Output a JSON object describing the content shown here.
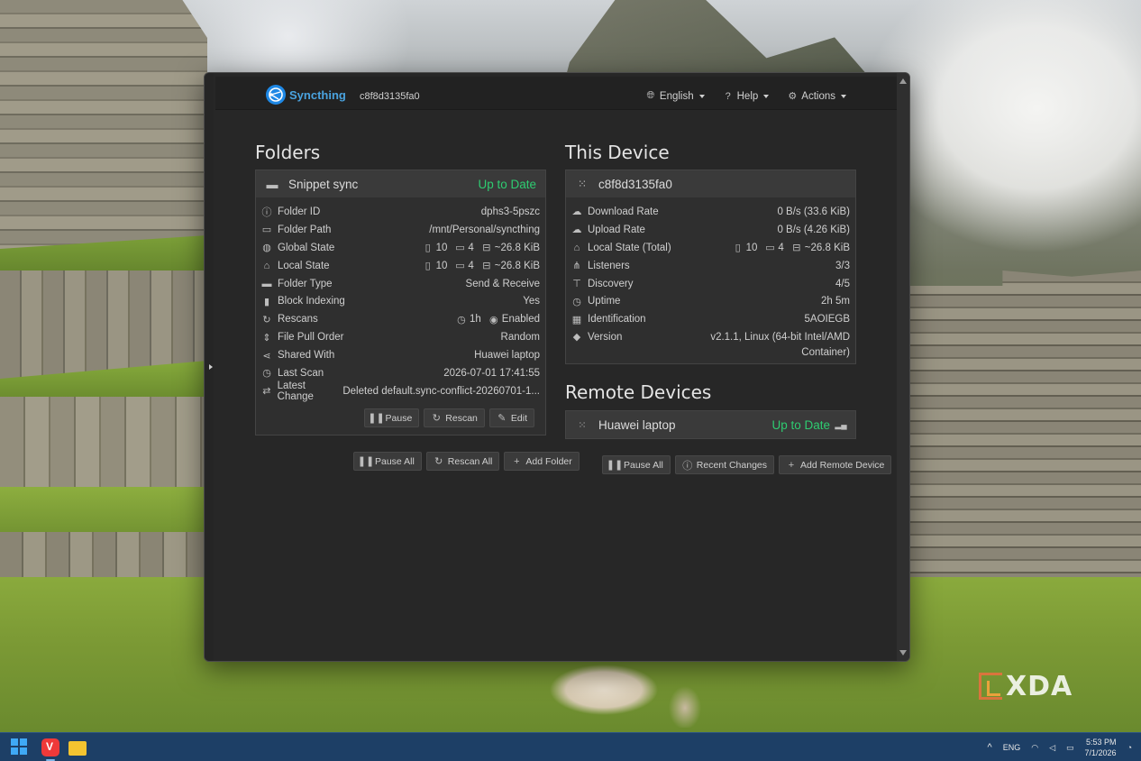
{
  "app": {
    "brand": "Syncthing",
    "device_id": "c8f8d3135fa0",
    "nav": {
      "language": "English",
      "help": "Help",
      "actions": "Actions"
    }
  },
  "folders": {
    "heading": "Folders",
    "panel": {
      "name": "Snippet sync",
      "status": "Up to Date",
      "rows": [
        {
          "icon": "info-icon",
          "label": "Folder ID",
          "value": "dphs3-5pszc"
        },
        {
          "icon": "folder-open-icon",
          "label": "Folder Path",
          "value": "/mnt/Personal/syncthing"
        },
        {
          "icon": "globe-icon",
          "label": "Global State",
          "files": "10",
          "dirs": "4",
          "size": "~26.8 KiB"
        },
        {
          "icon": "home-icon",
          "label": "Local State",
          "files": "10",
          "dirs": "4",
          "size": "~26.8 KiB"
        },
        {
          "icon": "folder-icon",
          "label": "Folder Type",
          "value": "Send & Receive"
        },
        {
          "icon": "book-icon",
          "label": "Block Indexing",
          "value": "Yes"
        },
        {
          "icon": "refresh-icon",
          "label": "Rescans",
          "interval": "1h",
          "watch": "Enabled"
        },
        {
          "icon": "sort-icon",
          "label": "File Pull Order",
          "value": "Random"
        },
        {
          "icon": "share-icon",
          "label": "Shared With",
          "value": "Huawei laptop"
        },
        {
          "icon": "clock-icon",
          "label": "Last Scan",
          "value": "2026-07-01 17:41:55"
        },
        {
          "icon": "exchange-icon",
          "label": "Latest Change",
          "value": "Deleted default.sync-conflict-20260701-1..."
        }
      ],
      "buttons": {
        "pause": "Pause",
        "rescan": "Rescan",
        "edit": "Edit"
      }
    },
    "buttons": {
      "pause_all": "Pause All",
      "rescan_all": "Rescan All",
      "add_folder": "Add Folder"
    }
  },
  "this_device": {
    "heading": "This Device",
    "name": "c8f8d3135fa0",
    "rows": [
      {
        "icon": "cloud-download-icon",
        "label": "Download Rate",
        "value": "0 B/s (33.6 KiB)"
      },
      {
        "icon": "cloud-upload-icon",
        "label": "Upload Rate",
        "value": "0 B/s (4.26 KiB)"
      },
      {
        "icon": "home-icon",
        "label": "Local State (Total)",
        "files": "10",
        "dirs": "4",
        "size": "~26.8 KiB"
      },
      {
        "icon": "sitemap-icon",
        "label": "Listeners",
        "value": "3/3"
      },
      {
        "icon": "signpost-icon",
        "label": "Discovery",
        "value": "4/5"
      },
      {
        "icon": "clock-icon",
        "label": "Uptime",
        "value": "2h 5m"
      },
      {
        "icon": "qrcode-icon",
        "label": "Identification",
        "value": "5AOIEGB"
      },
      {
        "icon": "tag-icon",
        "label": "Version",
        "value_line1": "v2.1.1, Linux (64-bit Intel/AMD",
        "value_line2": "Container)"
      }
    ]
  },
  "remote_devices": {
    "heading": "Remote Devices",
    "device": {
      "name": "Huawei laptop",
      "status": "Up to Date"
    },
    "buttons": {
      "pause_all": "Pause All",
      "recent_changes": "Recent Changes",
      "add_remote": "Add Remote Device"
    }
  },
  "watermark": "XDA",
  "taskbar": {
    "lang": "ENG",
    "time": "5:53 PM",
    "date": "7/1/2026"
  },
  "colors": {
    "accent": "#4aa3df",
    "ok": "#2ecc71",
    "panel": "#2f2f2f",
    "panel_head": "#3a3a3a"
  }
}
